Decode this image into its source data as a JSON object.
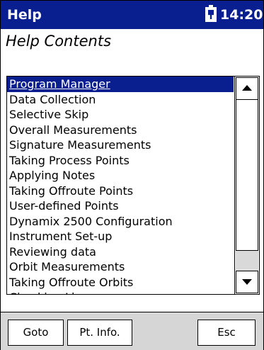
{
  "titlebar": {
    "title": "Help",
    "time": "14:20"
  },
  "heading": "Help Contents",
  "list": {
    "items": [
      "Program Manager",
      "Data Collection",
      "Selective Skip",
      "Overall Measurements",
      "Signature Measurements",
      "Taking Process Points",
      "Applying Notes",
      "Taking Offroute Points",
      "User-defined Points",
      "Dynamix 2500 Configuration",
      "Instrument Set-up",
      "Reviewing data",
      "Orbit Measurements",
      "Taking Offroute Orbits",
      "Checking Licenses"
    ],
    "selected": "Program Manager"
  },
  "buttons": {
    "goto": "Goto",
    "info": "Pt. Info.",
    "esc": "Esc"
  },
  "colors": {
    "titlebar": "#0a1f8f",
    "selection": "#0a1f8f",
    "button_bar": "#d6d6d6"
  },
  "icons": [
    "battery-icon",
    "scroll-up-arrow-icon",
    "scroll-down-arrow-icon"
  ]
}
